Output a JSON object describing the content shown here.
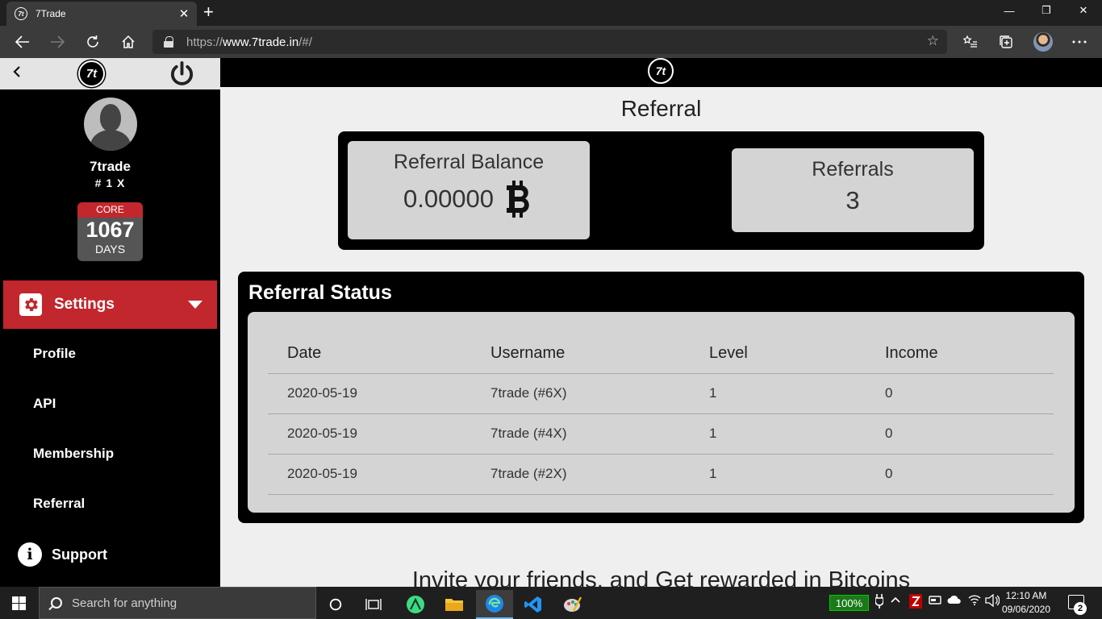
{
  "browser": {
    "tab_title": "7Trade",
    "favicon_text": "7t",
    "tab_close": "✕",
    "new_tab": "+",
    "url_prefix": "https://",
    "url_host": "www.7trade.in",
    "url_path": "/#/",
    "controls": {
      "minimize": "—",
      "restore": "❐",
      "close": "✕"
    },
    "icons": [
      "back-icon",
      "forward-icon",
      "refresh-icon",
      "home-icon",
      "lock-icon",
      "favorite-star-icon",
      "favorites-list-icon",
      "collections-icon",
      "profile-avatar-icon",
      "more-icon"
    ]
  },
  "sidebar": {
    "logo_text": "7t",
    "username": "7trade",
    "rank": "# 1 X",
    "core_badge": {
      "label": "CORE",
      "value": "1067",
      "unit": "DAYS"
    },
    "settings_label": "Settings",
    "items": [
      {
        "label": "Profile"
      },
      {
        "label": "API"
      },
      {
        "label": "Membership"
      },
      {
        "label": "Referral"
      }
    ],
    "support_label": "Support"
  },
  "main": {
    "logo_text": "7t",
    "title": "Referral",
    "balance": {
      "label": "Referral Balance",
      "value": "0.00000"
    },
    "referrals": {
      "label": "Referrals",
      "value": "3"
    },
    "status_title": "Referral Status",
    "table": {
      "headers": {
        "date": "Date",
        "username": "Username",
        "level": "Level",
        "income": "Income"
      },
      "rows": [
        {
          "date": "2020-05-19",
          "username": "7trade (#6X)",
          "level": "1",
          "income": "0"
        },
        {
          "date": "2020-05-19",
          "username": "7trade (#4X)",
          "level": "1",
          "income": "0"
        },
        {
          "date": "2020-05-19",
          "username": "7trade (#2X)",
          "level": "1",
          "income": "0"
        }
      ]
    },
    "invite_text": "Invite your friends, and Get rewarded in Bitcoins"
  },
  "taskbar": {
    "search_placeholder": "Search for anything",
    "battery": "100%",
    "time": "12:10 AM",
    "date": "09/06/2020",
    "notification_count": "2",
    "apps": [
      "cortana-icon",
      "task-view-icon",
      "android-studio-icon",
      "file-explorer-icon",
      "edge-icon",
      "vscode-icon",
      "paint-icon"
    ]
  },
  "colors": {
    "accent_red": "#c1272d",
    "card_gray": "#d4d4d4",
    "page_bg": "#efefef",
    "panel_black": "#000000"
  }
}
